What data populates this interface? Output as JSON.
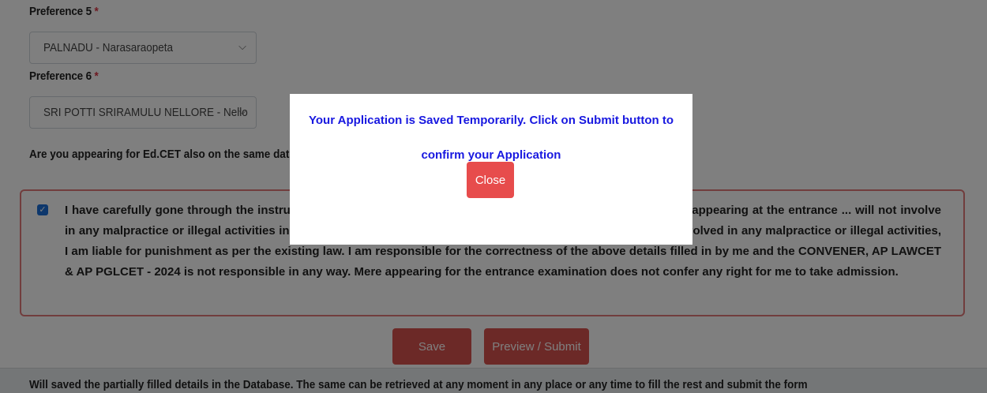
{
  "form": {
    "preference5": {
      "label": "Preference 5",
      "required_mark": "*",
      "selected": "PALNADU - Narasaraopeta"
    },
    "preference6": {
      "label": "Preference 6",
      "required_mark": "*",
      "selected": "SRI POTTI SRIRAMULU NELLORE - Nello"
    },
    "edcet_question": "Are you appearing for Ed.CET also on the same date",
    "declaration": {
      "checked": true,
      "text": "I have carefully gone through the instructions ... eligibility conditions and other regulations to be satisfied for appearing at the entrance ... will not involve in any malpractice or illegal activities in the entrance test. In case, I have furnished any false information or involved in any malpractice or illegal activities, I am liable for punishment as per the existing law. I am responsible for the correctness of the above details filled in by me and the CONVENER, AP LAWCET & AP PGLCET - 2024 is not responsible in any way. Mere appearing for the entrance examination does not confer any right for me to take admission."
    },
    "save_label": "Save",
    "preview_submit_label": "Preview / Submit",
    "footer_note": "Will saved the partially filled details in the Database. The same can be retrieved at any moment in any place or any time to fill the rest and submit the form"
  },
  "modal": {
    "message": "Your Application is Saved Temporarily. Click on Submit button to confirm your Application",
    "close_label": "Close"
  },
  "colors": {
    "overlay": "#000000",
    "modal_text": "#1818e0",
    "button_red": "#d9534f",
    "declaration_border": "#e37a7a",
    "checkbox": "#1a6fd8"
  }
}
